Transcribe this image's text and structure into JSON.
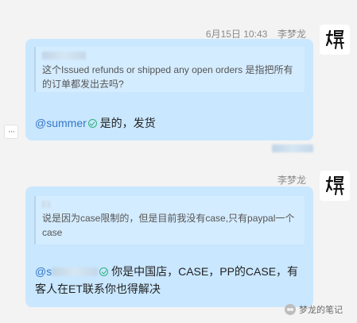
{
  "messages": [
    {
      "timestamp": "6月15日 10:43",
      "sender": "李梦龙",
      "quote_text": "这个Issued refunds or shipped any open orders 是指把所有的订单都发出去吗?",
      "mention": "@summer",
      "reply_text": "是的，发货"
    },
    {
      "sender": "李梦龙",
      "quote_text": "说是因为case限制的，但是目前我没有case,只有paypal一个case",
      "mention": "@s",
      "reply_text": "你是中国店，CASE，PP的CASE，有客人在ET联系你也得解决"
    }
  ],
  "watermark": {
    "text": "梦龙的笔记"
  },
  "icons": {
    "avatar": "calligraphy-avatar-icon",
    "more": "more-options-icon",
    "verified": "verified-check-icon",
    "watermark": "wechat-icon"
  },
  "colors": {
    "bubble": "#c9e7ff",
    "background": "#f3f3f3",
    "mention": "#3476c8",
    "verified": "#2fb27c"
  }
}
